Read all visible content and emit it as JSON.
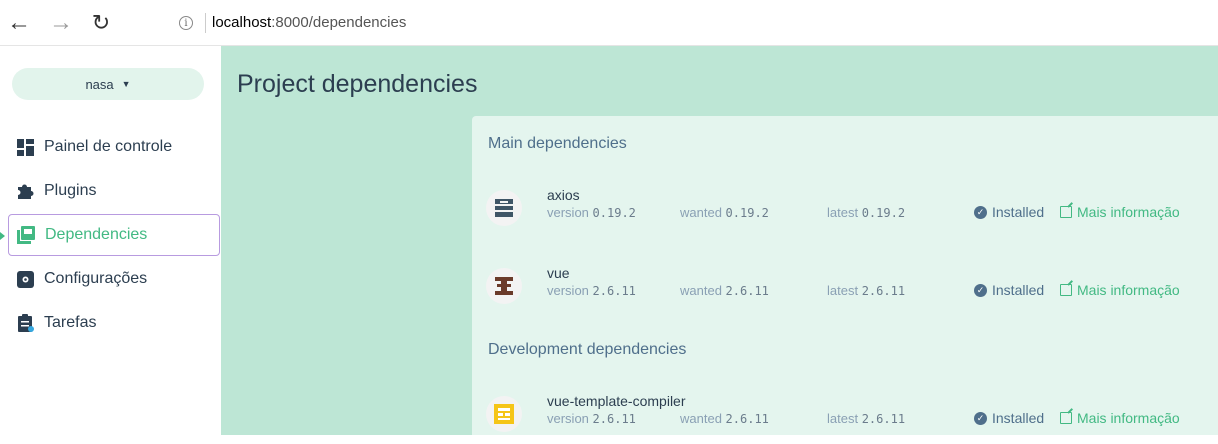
{
  "browser": {
    "back": "←",
    "forward": "→",
    "reload": "↻",
    "url_host": "localhost",
    "url_path": ":8000/dependencies"
  },
  "sidebar": {
    "project": "nasa",
    "items": [
      {
        "label": "Painel de controle",
        "icon": "dashboard-icon"
      },
      {
        "label": "Plugins",
        "icon": "puzzle-icon"
      },
      {
        "label": "Dependencies",
        "icon": "library-icon",
        "active": true
      },
      {
        "label": "Configurações",
        "icon": "settings-icon"
      },
      {
        "label": "Tarefas",
        "icon": "clipboard-icon"
      }
    ]
  },
  "main": {
    "title": "Project dependencies",
    "labels": {
      "version": "version",
      "wanted": "wanted",
      "latest": "latest",
      "installed": "Installed",
      "more": "Mais informação"
    },
    "main_section": "Main dependencies",
    "dev_section": "Development dependencies",
    "main_deps": [
      {
        "name": "axios",
        "version": "0.19.2",
        "wanted": "0.19.2",
        "latest": "0.19.2"
      },
      {
        "name": "vue",
        "version": "2.6.11",
        "wanted": "2.6.11",
        "latest": "2.6.11"
      }
    ],
    "dev_deps": [
      {
        "name": "vue-template-compiler",
        "version": "2.6.11",
        "wanted": "2.6.11",
        "latest": "2.6.11"
      }
    ]
  },
  "colors": {
    "accent": "#42b983",
    "main_bg": "#bde6d5",
    "panel_bg": "#e4f5ee",
    "muted": "#4f6f8b"
  }
}
